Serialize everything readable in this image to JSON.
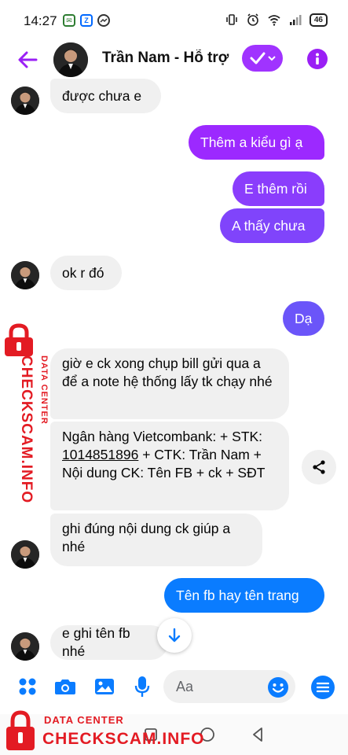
{
  "status_bar": {
    "time": "14:27",
    "battery": "46",
    "app_icons": [
      "wechat-icon",
      "zalo-icon",
      "messenger-icon"
    ],
    "right_icons": [
      "vibrate-icon",
      "alarm-icon",
      "wifi-icon",
      "signal-icon",
      "battery-icon"
    ]
  },
  "header": {
    "title": "Trần Nam - Hỗ trợ",
    "accent_color": "#a033ff"
  },
  "messages": [
    {
      "id": "m1",
      "direction": "in",
      "text": "được chưa e"
    },
    {
      "id": "m2",
      "direction": "out",
      "text": "Thêm a kiểu gì ạ"
    },
    {
      "id": "m3",
      "direction": "out",
      "text": "E thêm rồi"
    },
    {
      "id": "m4",
      "direction": "out",
      "text": "A thấy chưa"
    },
    {
      "id": "m5",
      "direction": "in",
      "text": "ok r đó"
    },
    {
      "id": "m6",
      "direction": "out",
      "text": "Dạ"
    },
    {
      "id": "m7",
      "direction": "in",
      "text": "giờ e ck xong chụp bill gửi qua a để a note hệ thống lấy tk chạy nhé"
    },
    {
      "id": "m8",
      "direction": "in",
      "text_before": "Ngân hàng Vietcombank: + STK: ",
      "account_number": "1014851896",
      "text_after": " + CTK: Trần Nam + Nội dung CK: Tên FB + ck + SĐT"
    },
    {
      "id": "m9",
      "direction": "in",
      "text": "ghi đúng nội dung ck giúp a nhé"
    },
    {
      "id": "m10",
      "direction": "out",
      "text": "Tên fb hay tên trang"
    },
    {
      "id": "m11",
      "direction": "in",
      "text": "e ghi tên fb nhé"
    }
  ],
  "composer": {
    "placeholder": "Aa",
    "buttons": [
      "apps-icon",
      "camera-icon",
      "gallery-icon",
      "microphone-icon",
      "emoji-icon",
      "menu-icon"
    ]
  },
  "watermark": {
    "small_text": "DATA CENTER",
    "big_text": "CHECKSCAM.INFO"
  },
  "colors": {
    "bubble_in": "#f0f0f0",
    "bubble_out_purple": "#a033ff",
    "bubble_out_blue": "#0a7cff",
    "watermark_red": "#e31b23"
  }
}
